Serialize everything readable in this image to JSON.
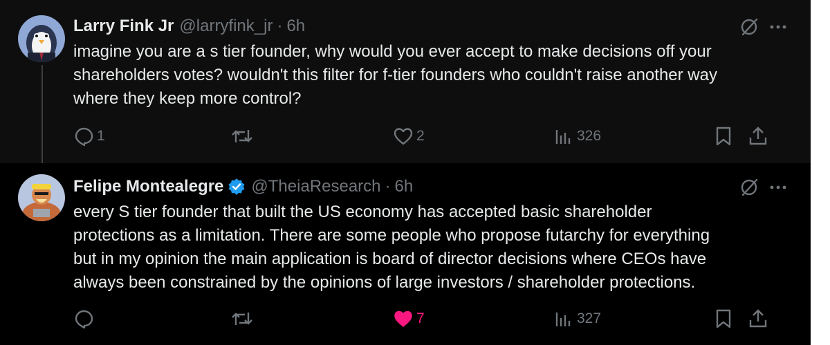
{
  "tweets": [
    {
      "author_name": "Larry Fink Jr",
      "handle": "@larryfink_jr",
      "separator": "·",
      "time": "6h",
      "verified": false,
      "text_lines": [
        "imagine you are a s tier founder, why would you ever accept to make decisions off your",
        "shareholders votes? wouldn't this filter for f-tier founders who couldn't raise another way",
        "where they keep more control?"
      ],
      "actions": {
        "replies": "1",
        "retweets": "",
        "likes": "2",
        "views": "326"
      },
      "liked": false
    },
    {
      "author_name": "Felipe Montealegre",
      "handle": "@TheiaResearch",
      "separator": "·",
      "time": "6h",
      "verified": true,
      "text_lines": [
        "every S tier founder that built the US economy has accepted basic shareholder",
        "protections as a limitation. There are some people who propose futarchy for everything",
        "but in my opinion the main application is board of director decisions where CEOs have",
        "always been constrained by the opinions of large investors / shareholder protections."
      ],
      "actions": {
        "replies": "",
        "retweets": "",
        "likes": "7",
        "views": "327"
      },
      "liked": true
    }
  ],
  "icons": {
    "reply": "reply-icon",
    "retweet": "retweet-icon",
    "like": "heart-icon",
    "views": "views-icon",
    "bookmark": "bookmark-icon",
    "share": "share-icon",
    "grok": "grok-icon",
    "more": "more-icon",
    "verified": "verified-badge-icon"
  },
  "colors": {
    "background": "#000000",
    "text_primary": "#e7e9ea",
    "text_secondary": "#71767b",
    "like_active": "#f91880",
    "verified_blue": "#1d9bf0"
  }
}
